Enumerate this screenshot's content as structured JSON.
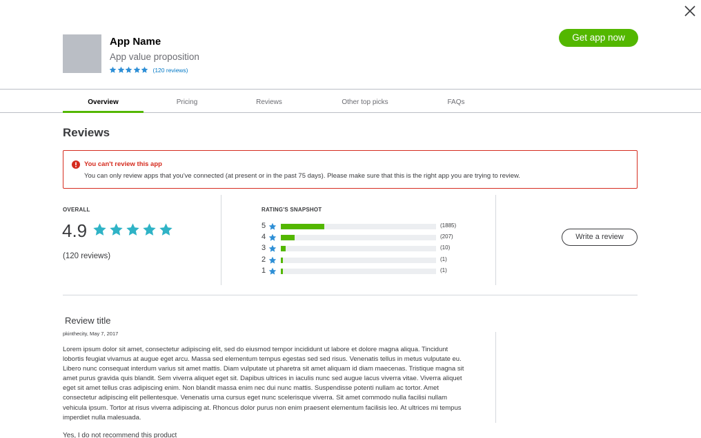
{
  "header": {
    "app_name": "App Name",
    "app_value": "App value proposition",
    "review_count": "(120 reviews)",
    "get_app_label": "Get app now",
    "rating_stars": 5
  },
  "tabs": [
    {
      "label": "Overview",
      "active": true
    },
    {
      "label": "Pricing",
      "active": false
    },
    {
      "label": "Reviews",
      "active": false
    },
    {
      "label": "Other top picks",
      "active": false
    },
    {
      "label": "FAQs",
      "active": false
    }
  ],
  "reviews_section": {
    "title": "Reviews",
    "alert": {
      "title": "You can't review this app",
      "message": "You can only review apps that you've connected (at present or in the past 75 days). Please make sure that this is the right app you are trying to review."
    },
    "overall": {
      "label": "OVERALL",
      "score": "4.9",
      "count": "(120 reviews)"
    },
    "snapshot": {
      "label": "RATING'S SNAPSHOT",
      "rows": [
        {
          "stars": "5",
          "count": "(1885)",
          "fraction": 0.28
        },
        {
          "stars": "4",
          "count": "(207)",
          "fraction": 0.09
        },
        {
          "stars": "3",
          "count": "(10)",
          "fraction": 0.03
        },
        {
          "stars": "2",
          "count": "(1)",
          "fraction": 0.01
        },
        {
          "stars": "1",
          "count": "(1)",
          "fraction": 0.01
        }
      ]
    },
    "write_review_label": "Write a review",
    "review": {
      "title": "Review title",
      "meta": "pkinthecity, May 7, 2017",
      "body": "Lorem ipsum dolor sit amet, consectetur adipiscing elit, sed do eiusmod tempor incididunt ut labore et dolore magna aliqua. Tincidunt lobortis feugiat vivamus at augue eget arcu. Massa sed elementum tempus egestas sed sed risus. Venenatis tellus in metus vulputate eu. Libero nunc consequat interdum varius sit amet mattis. Diam vulputate ut pharetra sit amet aliquam id diam maecenas. Tristique magna sit amet purus gravida quis blandit. Sem viverra aliquet eget sit. Dapibus ultrices in iaculis nunc sed augue lacus viverra vitae. Viverra aliquet eget sit amet tellus cras adipiscing enim. Non blandit massa enim nec dui nunc mattis. Suspendisse potenti nullam ac tortor. Amet consectetur adipiscing elit pellentesque. Venenatis urna cursus eget nunc scelerisque viverra. Sit amet commodo nulla facilisi nullam vehicula ipsum. Tortor at risus viverra adipiscing at. Rhoncus dolor purus non enim praesent elementum facilisis leo. At ultrices mi tempus imperdiet nulla malesuada.",
      "recommend": "Yes, I do not recommend this product"
    }
  },
  "colors": {
    "accent_green": "#53b700",
    "star_blue": "#2ca01c",
    "alert_red": "#d52b1e",
    "link_blue": "#0077c5"
  },
  "icons": {
    "close": "close-icon",
    "star": "star-icon",
    "alert": "alert-icon"
  }
}
